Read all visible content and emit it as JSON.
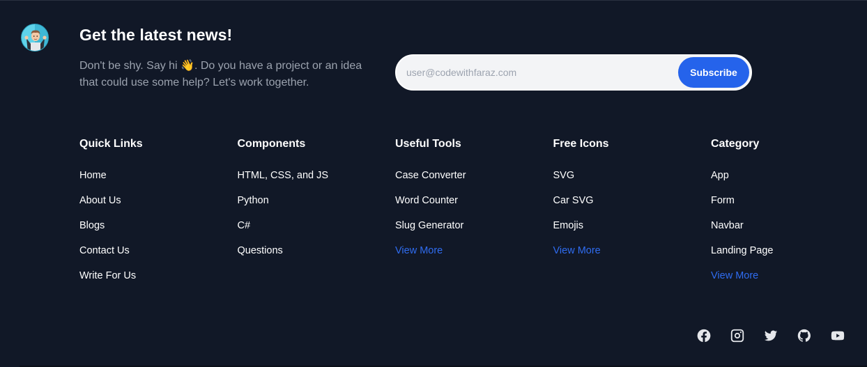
{
  "newsletter": {
    "title": "Get the latest news!",
    "description": "Don't be shy. Say hi 👋. Do you have a project or an idea that could use some help? Let's work together.",
    "email_placeholder": "user@codewithfaraz.com",
    "email_value": "",
    "subscribe_label": "Subscribe"
  },
  "columns": [
    {
      "title": "Quick Links",
      "links": [
        {
          "label": "Home",
          "highlight": false
        },
        {
          "label": "About Us",
          "highlight": false
        },
        {
          "label": "Blogs",
          "highlight": false
        },
        {
          "label": "Contact Us",
          "highlight": false
        },
        {
          "label": "Write For Us",
          "highlight": false
        }
      ]
    },
    {
      "title": "Components",
      "links": [
        {
          "label": "HTML, CSS, and JS",
          "highlight": false
        },
        {
          "label": "Python",
          "highlight": false
        },
        {
          "label": "C#",
          "highlight": false
        },
        {
          "label": "Questions",
          "highlight": false
        }
      ]
    },
    {
      "title": "Useful Tools",
      "links": [
        {
          "label": "Case Converter",
          "highlight": false
        },
        {
          "label": "Word Counter",
          "highlight": false
        },
        {
          "label": "Slug Generator",
          "highlight": false
        },
        {
          "label": "View More",
          "highlight": true
        }
      ]
    },
    {
      "title": "Free Icons",
      "links": [
        {
          "label": "SVG",
          "highlight": false
        },
        {
          "label": "Car SVG",
          "highlight": false
        },
        {
          "label": "Emojis",
          "highlight": false
        },
        {
          "label": "View More",
          "highlight": true
        }
      ]
    },
    {
      "title": "Category",
      "links": [
        {
          "label": "App",
          "highlight": false
        },
        {
          "label": "Form",
          "highlight": false
        },
        {
          "label": "Navbar",
          "highlight": false
        },
        {
          "label": "Landing Page",
          "highlight": false
        },
        {
          "label": "View More",
          "highlight": true
        }
      ]
    }
  ],
  "socials": [
    "facebook-icon",
    "instagram-icon",
    "twitter-icon",
    "github-icon",
    "youtube-icon"
  ],
  "colors": {
    "background": "#111827",
    "accent": "#2563eb",
    "link_highlight": "#2f6cf0",
    "muted_text": "#9ca3af"
  }
}
